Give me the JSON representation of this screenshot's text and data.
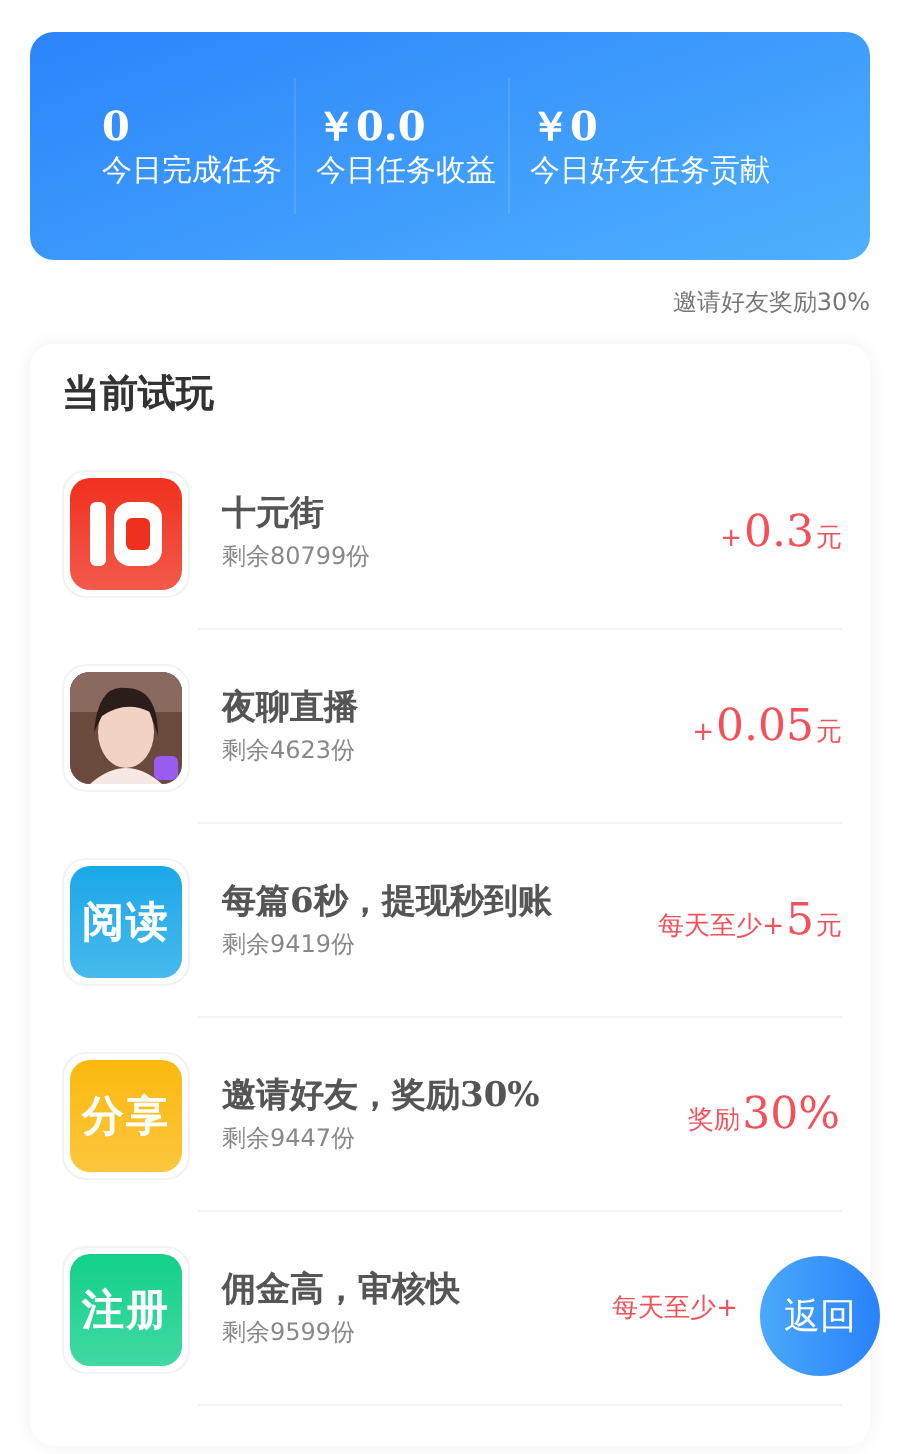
{
  "stats": [
    {
      "value": "0",
      "label": "今日完成任务"
    },
    {
      "value": "￥0.0",
      "label": "今日任务收益"
    },
    {
      "value": "￥0",
      "label": "今日好友任务贡献"
    }
  ],
  "invite_note": "邀请好友奖励30%",
  "section_title": "当前试玩",
  "tasks": [
    {
      "icon": {
        "kind": "grid_logo",
        "color": "#f0301e"
      },
      "title": "十元街",
      "remaining": "剩余80799份",
      "reward": {
        "prefix": "+",
        "value": "0.3",
        "unit": "元"
      }
    },
    {
      "title": "夜聊直播",
      "remaining": "剩余4623份",
      "reward": {
        "prefix": "+",
        "value": "0.05",
        "unit": "元"
      }
    },
    {
      "icon": {
        "kind": "label",
        "label": "阅读",
        "color": "#1aa8e8"
      },
      "title": "每篇6秒，提现秒到账",
      "remaining": "剩余9419份",
      "reward": {
        "prefix": "每天至少+",
        "value": "5",
        "unit": "元"
      }
    },
    {
      "icon": {
        "kind": "label",
        "label": "分享",
        "color": "#fbb80e"
      },
      "title": "邀请好友，奖励30%",
      "remaining": "剩余9447份",
      "reward": {
        "prefix": "奖励",
        "value": "30%"
      }
    },
    {
      "icon": {
        "kind": "label",
        "label": "注册",
        "color": "#12d08a"
      },
      "title": "佣金高，审核快",
      "remaining": "剩余9599份",
      "reward": {
        "prefix": "每天至少+"
      }
    }
  ],
  "back_button": "返回"
}
